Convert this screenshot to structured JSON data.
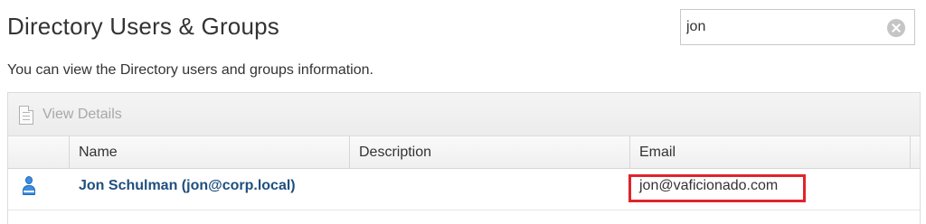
{
  "page": {
    "title": "Directory Users & Groups",
    "description": "You can view the Directory users and groups information."
  },
  "search": {
    "value": "jon",
    "placeholder": ""
  },
  "toolbar": {
    "view_details_label": "View Details"
  },
  "table": {
    "columns": [
      "Name",
      "Description",
      "Email"
    ],
    "rows": [
      {
        "type_icon": "user-icon",
        "name": "Jon Schulman (jon@corp.local)",
        "description": "",
        "email": "jon@vaficionado.com",
        "email_highlighted": true
      }
    ]
  },
  "colors": {
    "highlight_border": "#e0242c",
    "name_text": "#1f4f7e",
    "user_icon": "#3d8ee0"
  }
}
